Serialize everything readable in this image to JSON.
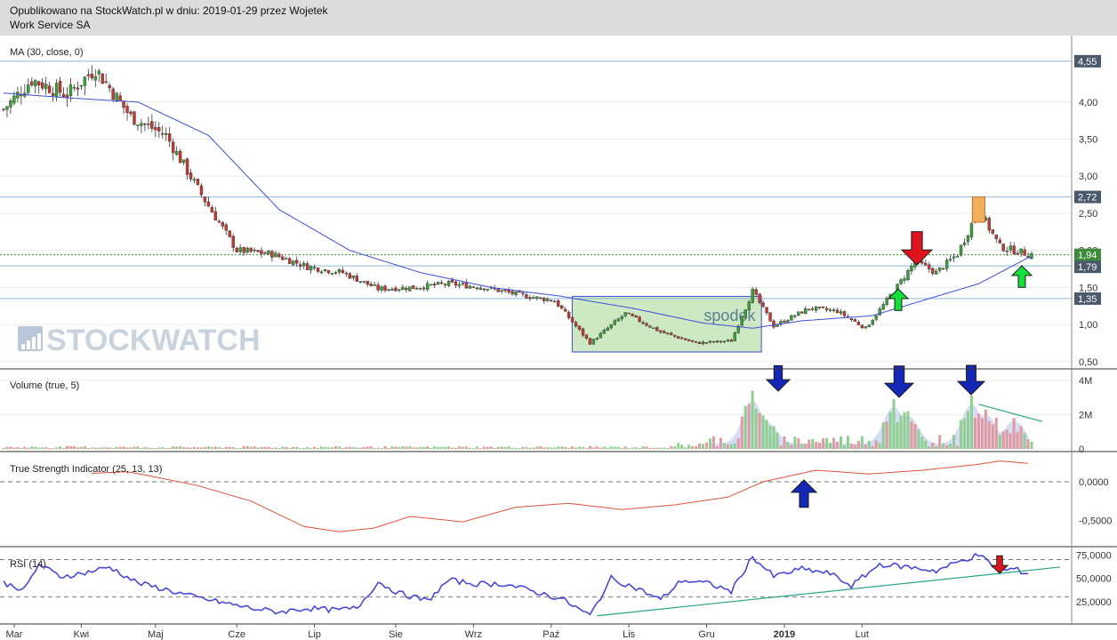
{
  "header": {
    "published": "Opublikowano na StockWatch.pl w dniu: 2019-01-29 przez Wojetek",
    "company": "Work Service SA"
  },
  "watermark": "STOCKWATCH",
  "annotation_box_label": "spodek",
  "colors": {
    "up": "#3aa13a",
    "down": "#c23b33",
    "ma": "#3c4fd8",
    "hline": "#8fb8d8",
    "tsi": "#e0503a",
    "rsi": "#4848d8",
    "trend": "#2aa58a",
    "box_fill": "#bfe0b0",
    "red_arrow": "#e0141e",
    "green_arrow": "#14e03c",
    "blue_arrow": "#1428b8",
    "panel_border": "#333333",
    "grid": "#ececec",
    "axis_label_bg": "#4a5a6a",
    "price_label_bg": "#3c8c3c"
  },
  "chart_data": [
    {
      "type": "candlestick",
      "title": "MA (30, close, 0)",
      "y_ticks": [
        "4,00",
        "3,50",
        "3,00",
        "2,50",
        "2,00",
        "1,50",
        "1,00",
        "0,50"
      ],
      "ylim": [
        0.45,
        4.8
      ],
      "horizontal_lines": [
        4.55,
        2.72,
        1.79,
        1.35
      ],
      "labeled_levels": [
        "4,55",
        "2,72",
        "1,94",
        "1,79",
        "1,35"
      ],
      "last_price": "1,94",
      "x_month_labels": [
        "Mar",
        "Kwi",
        "Maj",
        "Cze",
        "Lip",
        "Sie",
        "Wrz",
        "Paź",
        "Lis",
        "Gru",
        "2019",
        "Lut"
      ],
      "close_anchors": [
        [
          0,
          3.9
        ],
        [
          8,
          4.3
        ],
        [
          18,
          4.1
        ],
        [
          26,
          4.45
        ],
        [
          36,
          3.8
        ],
        [
          46,
          3.55
        ],
        [
          56,
          2.75
        ],
        [
          66,
          2.0
        ],
        [
          76,
          1.95
        ],
        [
          86,
          1.78
        ],
        [
          96,
          1.7
        ],
        [
          106,
          1.48
        ],
        [
          116,
          1.5
        ],
        [
          126,
          1.55
        ],
        [
          136,
          1.5
        ],
        [
          146,
          1.4
        ],
        [
          156,
          1.32
        ],
        [
          166,
          0.75
        ],
        [
          176,
          1.15
        ],
        [
          186,
          0.9
        ],
        [
          196,
          0.75
        ],
        [
          206,
          0.78
        ],
        [
          212,
          1.45
        ],
        [
          218,
          0.98
        ],
        [
          228,
          1.22
        ],
        [
          236,
          1.18
        ],
        [
          244,
          0.95
        ],
        [
          252,
          1.45
        ],
        [
          258,
          1.85
        ],
        [
          264,
          1.7
        ],
        [
          270,
          1.95
        ],
        [
          276,
          2.55
        ],
        [
          282,
          2.05
        ],
        [
          290,
          1.95
        ]
      ],
      "ma_anchors": [
        [
          0,
          4.12
        ],
        [
          20,
          4.05
        ],
        [
          38,
          4.0
        ],
        [
          58,
          3.55
        ],
        [
          78,
          2.55
        ],
        [
          98,
          2.0
        ],
        [
          118,
          1.7
        ],
        [
          138,
          1.5
        ],
        [
          158,
          1.38
        ],
        [
          178,
          1.22
        ],
        [
          198,
          1.02
        ],
        [
          212,
          0.95
        ],
        [
          226,
          1.05
        ],
        [
          246,
          1.12
        ],
        [
          262,
          1.35
        ],
        [
          276,
          1.55
        ],
        [
          290,
          1.9
        ]
      ],
      "total_bars": 292
    },
    {
      "type": "bar",
      "title": "Volume (true, 5)",
      "y_ticks": [
        "4M",
        "2M",
        "0"
      ],
      "ylim": [
        0,
        4200000
      ],
      "spike_anchors": [
        [
          212,
          3400000
        ],
        [
          216,
          1700000
        ],
        [
          252,
          2900000
        ],
        [
          256,
          2200000
        ],
        [
          274,
          3100000
        ],
        [
          278,
          2300000
        ],
        [
          286,
          1800000
        ]
      ]
    },
    {
      "type": "line",
      "title": "True Strength Indicator (25, 13, 13)",
      "y_ticks": [
        "0,0000",
        "-0,5000"
      ],
      "ylim": [
        -0.75,
        0.3
      ],
      "series": [
        {
          "points": [
            [
              25,
              0.11
            ],
            [
              35,
              0.13
            ],
            [
              42,
              0.07
            ],
            [
              55,
              -0.05
            ],
            [
              70,
              -0.25
            ],
            [
              85,
              -0.58
            ],
            [
              95,
              -0.65
            ],
            [
              105,
              -0.6
            ],
            [
              115,
              -0.45
            ],
            [
              130,
              -0.52
            ],
            [
              145,
              -0.33
            ],
            [
              160,
              -0.28
            ],
            [
              175,
              -0.36
            ],
            [
              190,
              -0.3
            ],
            [
              205,
              -0.2
            ],
            [
              215,
              0.0
            ],
            [
              230,
              0.15
            ],
            [
              245,
              0.1
            ],
            [
              260,
              0.15
            ],
            [
              275,
              0.22
            ],
            [
              282,
              0.27
            ],
            [
              290,
              0.24
            ]
          ]
        }
      ]
    },
    {
      "type": "line",
      "title": "RSI (14)",
      "y_ticks": [
        "75,0000",
        "50,0000",
        "25,0000"
      ],
      "ylim": [
        5,
        80
      ],
      "series": [
        {
          "points": [
            [
              0,
              45
            ],
            [
              6,
              38
            ],
            [
              10,
              65
            ],
            [
              16,
              52
            ],
            [
              22,
              55
            ],
            [
              30,
              62
            ],
            [
              38,
              45
            ],
            [
              46,
              38
            ],
            [
              54,
              30
            ],
            [
              62,
              24
            ],
            [
              70,
              18
            ],
            [
              78,
              14
            ],
            [
              86,
              18
            ],
            [
              94,
              16
            ],
            [
              100,
              18
            ],
            [
              106,
              46
            ],
            [
              112,
              34
            ],
            [
              120,
              26
            ],
            [
              126,
              48
            ],
            [
              134,
              44
            ],
            [
              142,
              44
            ],
            [
              150,
              36
            ],
            [
              158,
              28
            ],
            [
              166,
              10
            ],
            [
              172,
              50
            ],
            [
              180,
              38
            ],
            [
              186,
              27
            ],
            [
              192,
              48
            ],
            [
              200,
              44
            ],
            [
              206,
              36
            ],
            [
              212,
              73
            ],
            [
              218,
              52
            ],
            [
              226,
              60
            ],
            [
              234,
              55
            ],
            [
              240,
              42
            ],
            [
              248,
              65
            ],
            [
              256,
              62
            ],
            [
              264,
              58
            ],
            [
              272,
              70
            ],
            [
              276,
              75
            ],
            [
              282,
              58
            ],
            [
              286,
              60
            ],
            [
              290,
              55
            ]
          ]
        }
      ],
      "trendline": [
        [
          168,
          10
        ],
        [
          294,
          62
        ]
      ]
    }
  ]
}
